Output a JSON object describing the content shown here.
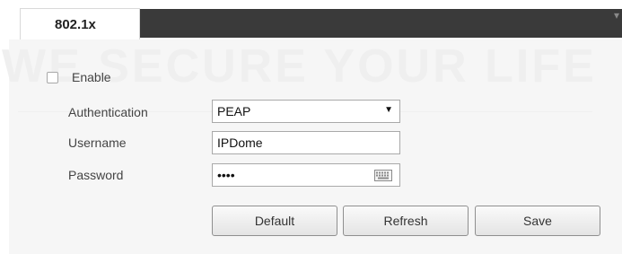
{
  "watermark": {
    "text": "WE SECURE YOUR LIFE",
    "stars": "★ ★ ★ ★ ★"
  },
  "tab": {
    "title": "802.1x"
  },
  "form": {
    "enable": {
      "label": "Enable",
      "checked": false
    },
    "authentication": {
      "label": "Authentication",
      "value": "PEAP",
      "icon": "chevron-down-icon",
      "arrow": "▼"
    },
    "username": {
      "label": "Username",
      "value": "IPDome"
    },
    "password": {
      "label": "Password",
      "value": "••••",
      "icon": "keyboard-icon"
    }
  },
  "buttons": {
    "default_label": "Default",
    "refresh_label": "Refresh",
    "save_label": "Save"
  },
  "colors": {
    "dark_bar": "#3a3a3a",
    "panel": "#f2f2f2",
    "field_border": "#a9a9a9"
  }
}
